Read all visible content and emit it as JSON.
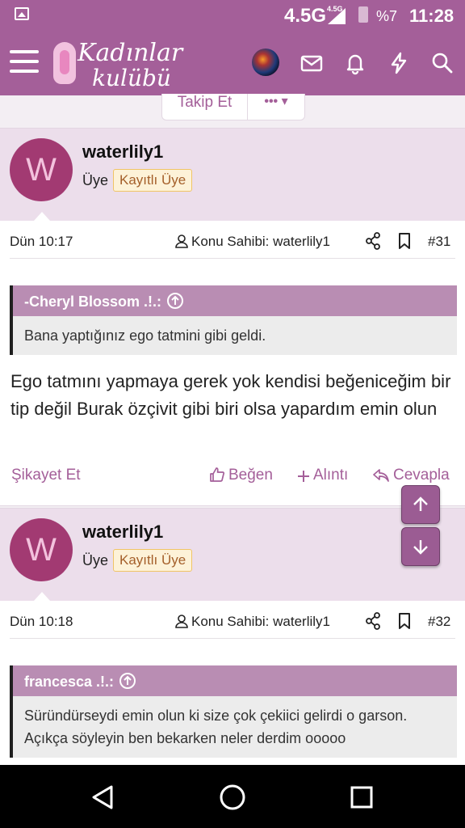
{
  "statusbar": {
    "network": "4.5G",
    "network_small": "4.5G",
    "battery": "%7",
    "time": "11:28"
  },
  "header": {
    "logo_line1": "Kadınlar",
    "logo_line2": "kulübü"
  },
  "thread_actions": {
    "follow_label": "Takip Et",
    "more_label": "•••"
  },
  "posts": [
    {
      "author": "waterlily1",
      "avatar_letter": "W",
      "role": "Üye",
      "badge": "Kayıtlı Üye",
      "date": "Dün 10:17",
      "owner_label": "Konu Sahibi: waterlily1",
      "number": "#31",
      "quote_author": "-Cheryl Blossom .!.:",
      "quote_text": "Bana yaptığınız ego tatmini gibi geldi.",
      "body": "Ego tatmını yapmaya gerek yok kendisi beğeniceğim bir tip değil Burak özçivit gibi biri olsa yapardım emin olun",
      "actions": {
        "report": "Şikayet Et",
        "like": "Beğen",
        "quote": "Alıntı",
        "reply": "Cevapla"
      }
    },
    {
      "author": "waterlily1",
      "avatar_letter": "W",
      "role": "Üye",
      "badge": "Kayıtlı Üye",
      "date": "Dün 10:18",
      "owner_label": "Konu Sahibi: waterlily1",
      "number": "#32",
      "quote_author": "francesca .!.:",
      "quote_text": "Süründürseydi emin olun ki size çok çekiici gelirdi o garson. Açıkça söyleyin ben bekarken neler derdim ooooo"
    }
  ],
  "colors": {
    "brand": "#a45f99",
    "header_bg": "#ecdeeb",
    "quote_head": "#b98db3",
    "avatar": "#a23a72",
    "badge_border": "#f0c466"
  },
  "icons": [
    "menu-icon",
    "mail-icon",
    "bell-icon",
    "bolt-icon",
    "search-icon",
    "user-icon",
    "share-icon",
    "bookmark-icon",
    "arrow-up-circle-icon",
    "thumbs-up-icon",
    "plus-icon",
    "reply-icon",
    "arrow-up-icon",
    "arrow-down-icon",
    "back-icon",
    "home-icon",
    "recents-icon"
  ]
}
